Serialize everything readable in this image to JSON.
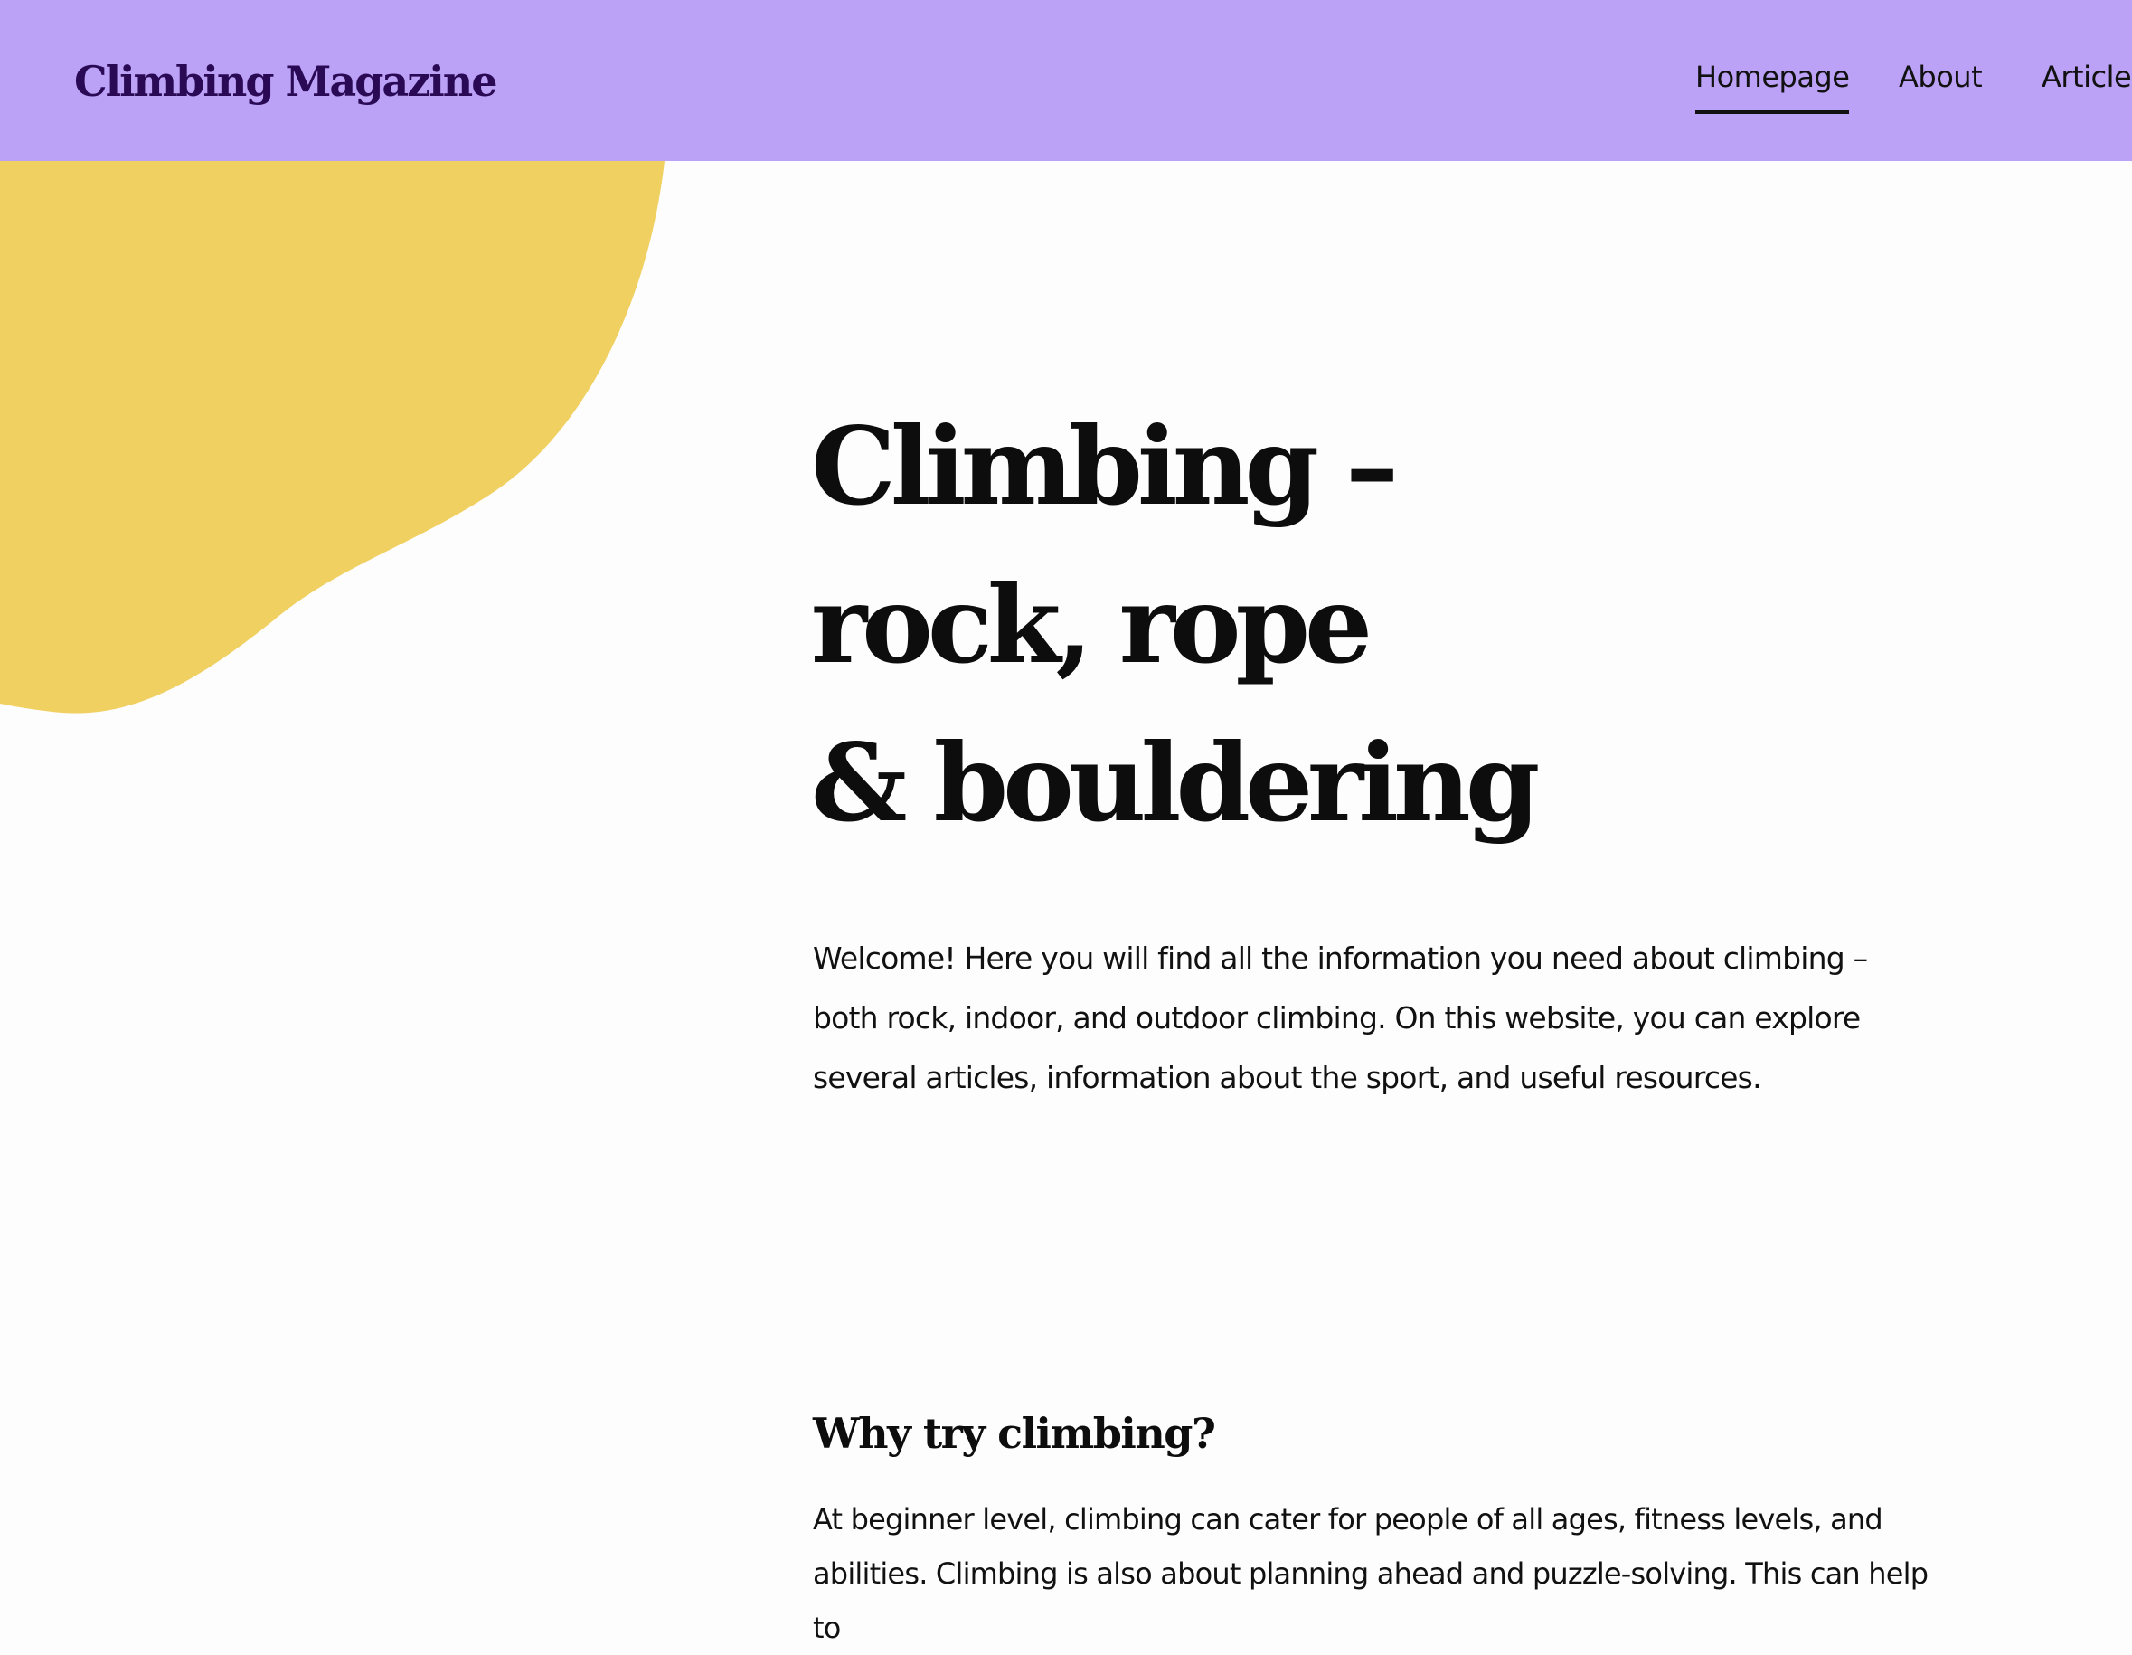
{
  "header": {
    "site_title": "Climbing Magazine",
    "background_color": "#bca2f7",
    "title_color": "#2a0a55"
  },
  "nav": {
    "items": [
      {
        "label": "Homepage",
        "active": true
      },
      {
        "label": "About",
        "active": false
      },
      {
        "label": "Articles",
        "active": false
      }
    ]
  },
  "decoration": {
    "blob_color": "#f0d060"
  },
  "hero": {
    "title_lines": [
      "Climbing –",
      "rock, rope",
      "& bouldering"
    ],
    "intro": "Welcome! Here you will find all the information you need about climbing – both rock, indoor, and outdoor climbing. On this website, you can explore several articles, information about the sport, and useful resources."
  },
  "section": {
    "heading": "Why try climbing?",
    "text": "At beginner level, climbing can cater for people of all ages, fitness levels, and abilities. Climbing is also about planning ahead and puzzle-solving. This can help to"
  }
}
